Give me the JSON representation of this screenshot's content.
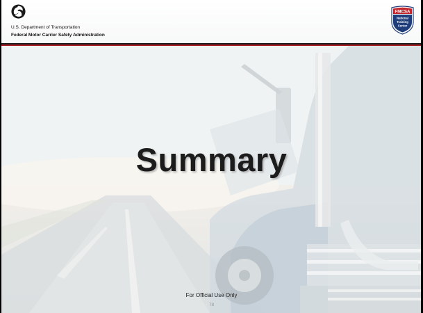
{
  "header": {
    "department": "U.S. Department of Transportation",
    "agency": "Federal Motor Carrier Safety Administration"
  },
  "badge": {
    "top_text": "FMCSA",
    "line1": "National",
    "line2": "Training",
    "line3": "Center"
  },
  "slide": {
    "title": "Summary"
  },
  "footer": {
    "note": "For Official Use Only",
    "page_number": "78"
  },
  "colors": {
    "badge_red": "#c1272d",
    "badge_blue": "#1f3d7a",
    "rule_red": "#a81d24"
  },
  "icons": {
    "dot_logo": "dot-triskelion-logo",
    "badge": "fmcsa-shield-badge"
  }
}
